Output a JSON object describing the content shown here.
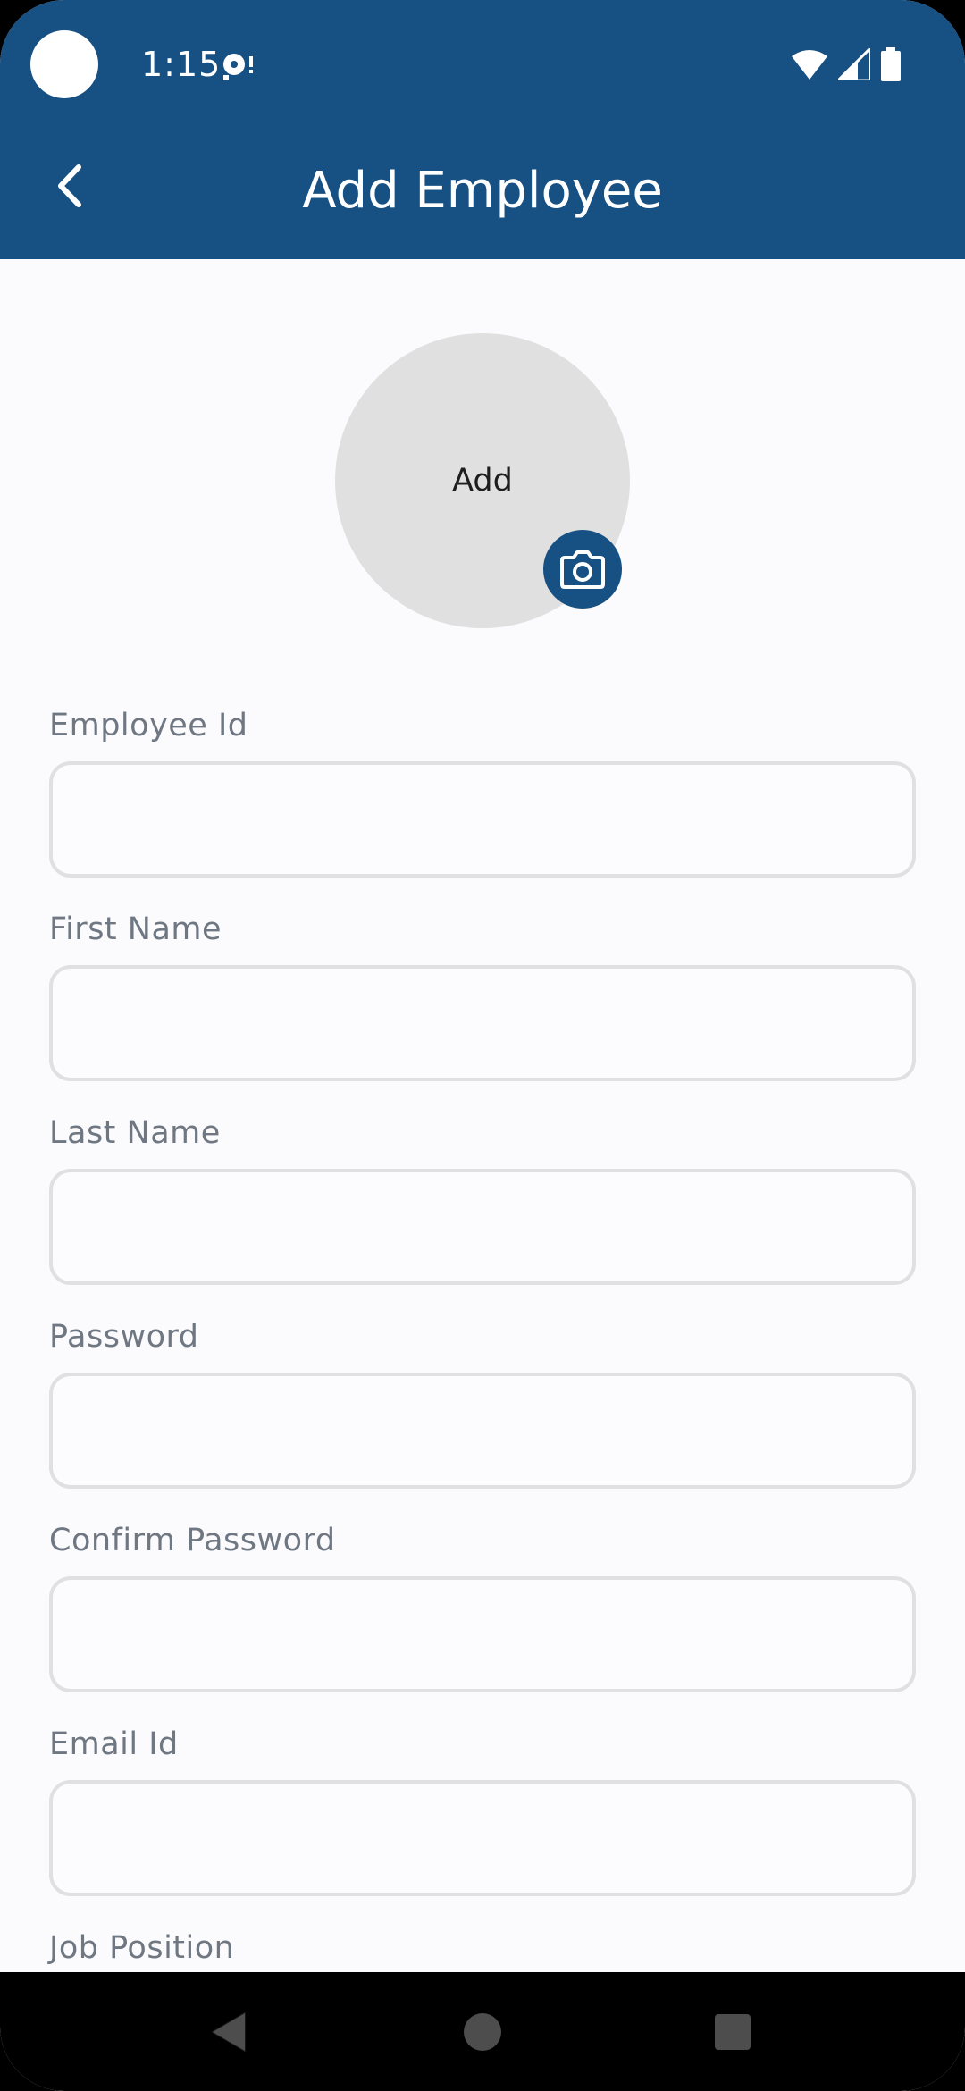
{
  "status_bar": {
    "time": "1:15"
  },
  "header": {
    "title": "Add Employee",
    "back_icon": "chevron-left-icon",
    "color": "#175082"
  },
  "avatar": {
    "label": "Add",
    "camera_icon": "camera-icon"
  },
  "form": {
    "fields": [
      {
        "label": "Employee Id",
        "value": "",
        "placeholder": ""
      },
      {
        "label": "First Name",
        "value": "",
        "placeholder": ""
      },
      {
        "label": "Last Name",
        "value": "",
        "placeholder": ""
      },
      {
        "label": "Password",
        "value": "",
        "placeholder": ""
      },
      {
        "label": "Confirm Password",
        "value": "",
        "placeholder": ""
      },
      {
        "label": "Email Id",
        "value": "",
        "placeholder": ""
      },
      {
        "label": "Job Position",
        "value": "",
        "placeholder": ""
      }
    ]
  },
  "nav_bar": {
    "back_icon": "triangle-back-icon",
    "home_icon": "circle-home-icon",
    "recents_icon": "square-recents-icon"
  }
}
